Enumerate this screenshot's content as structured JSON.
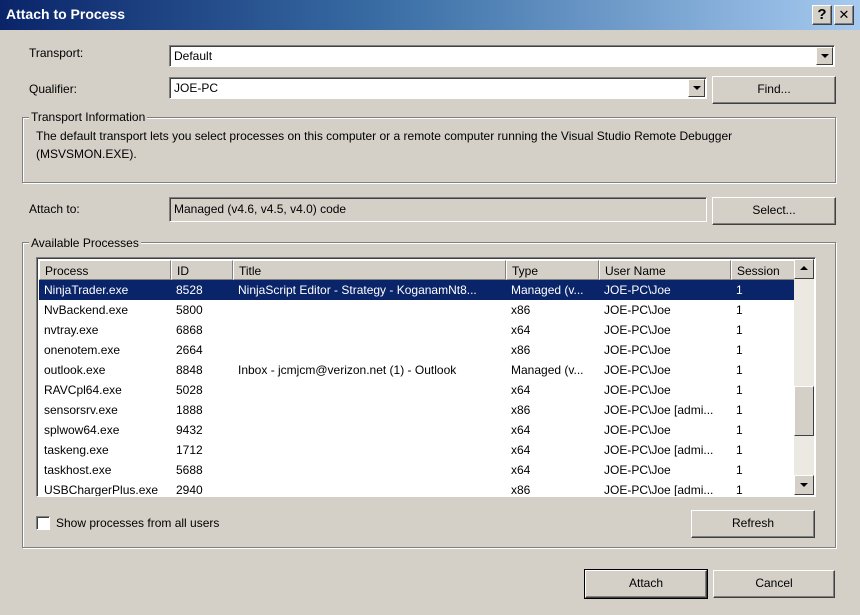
{
  "window": {
    "title": "Attach to Process",
    "help_glyph": "?",
    "close_glyph": "✕"
  },
  "transport": {
    "label": "Transport:",
    "value": "Default"
  },
  "qualifier": {
    "label": "Qualifier:",
    "value": "JOE-PC",
    "find_label": "Find..."
  },
  "transport_info": {
    "title": "Transport Information",
    "text_line1": "The default transport lets you select processes on this computer or a remote computer running the Visual Studio Remote Debugger",
    "text_line2": "(MSVSMON.EXE)."
  },
  "attach_to": {
    "label": "Attach to:",
    "value": "Managed (v4.6, v4.5, v4.0) code",
    "select_label": "Select..."
  },
  "processes": {
    "title": "Available Processes",
    "columns": [
      "Process",
      "ID",
      "Title",
      "Type",
      "User Name",
      "Session"
    ],
    "rows": [
      [
        "NinjaTrader.exe",
        "8528",
        "NinjaScript Editor - Strategy - KoganamNt8...",
        "Managed (v...",
        "JOE-PC\\Joe",
        "1"
      ],
      [
        "NvBackend.exe",
        "5800",
        "",
        "x86",
        "JOE-PC\\Joe",
        "1"
      ],
      [
        "nvtray.exe",
        "6868",
        "",
        "x64",
        "JOE-PC\\Joe",
        "1"
      ],
      [
        "onenotem.exe",
        "2664",
        "",
        "x86",
        "JOE-PC\\Joe",
        "1"
      ],
      [
        "outlook.exe",
        "8848",
        "Inbox - jcmjcm@verizon.net (1) - Outlook",
        "Managed (v...",
        "JOE-PC\\Joe",
        "1"
      ],
      [
        "RAVCpl64.exe",
        "5028",
        "",
        "x64",
        "JOE-PC\\Joe",
        "1"
      ],
      [
        "sensorsrv.exe",
        "1888",
        "",
        "x86",
        "JOE-PC\\Joe [admi...",
        "1"
      ],
      [
        "splwow64.exe",
        "9432",
        "",
        "x64",
        "JOE-PC\\Joe",
        "1"
      ],
      [
        "taskeng.exe",
        "1712",
        "",
        "x64",
        "JOE-PC\\Joe [admi...",
        "1"
      ],
      [
        "taskhost.exe",
        "5688",
        "",
        "x64",
        "JOE-PC\\Joe",
        "1"
      ],
      [
        "USBChargerPlus.exe",
        "2940",
        "",
        "x86",
        "JOE-PC\\Joe [admi...",
        "1"
      ]
    ],
    "selected_index": 0,
    "scroll_position": 0.72
  },
  "show_all_users": {
    "label": "Show processes from all users",
    "checked": false
  },
  "buttons": {
    "refresh": "Refresh",
    "attach": "Attach",
    "cancel": "Cancel"
  }
}
